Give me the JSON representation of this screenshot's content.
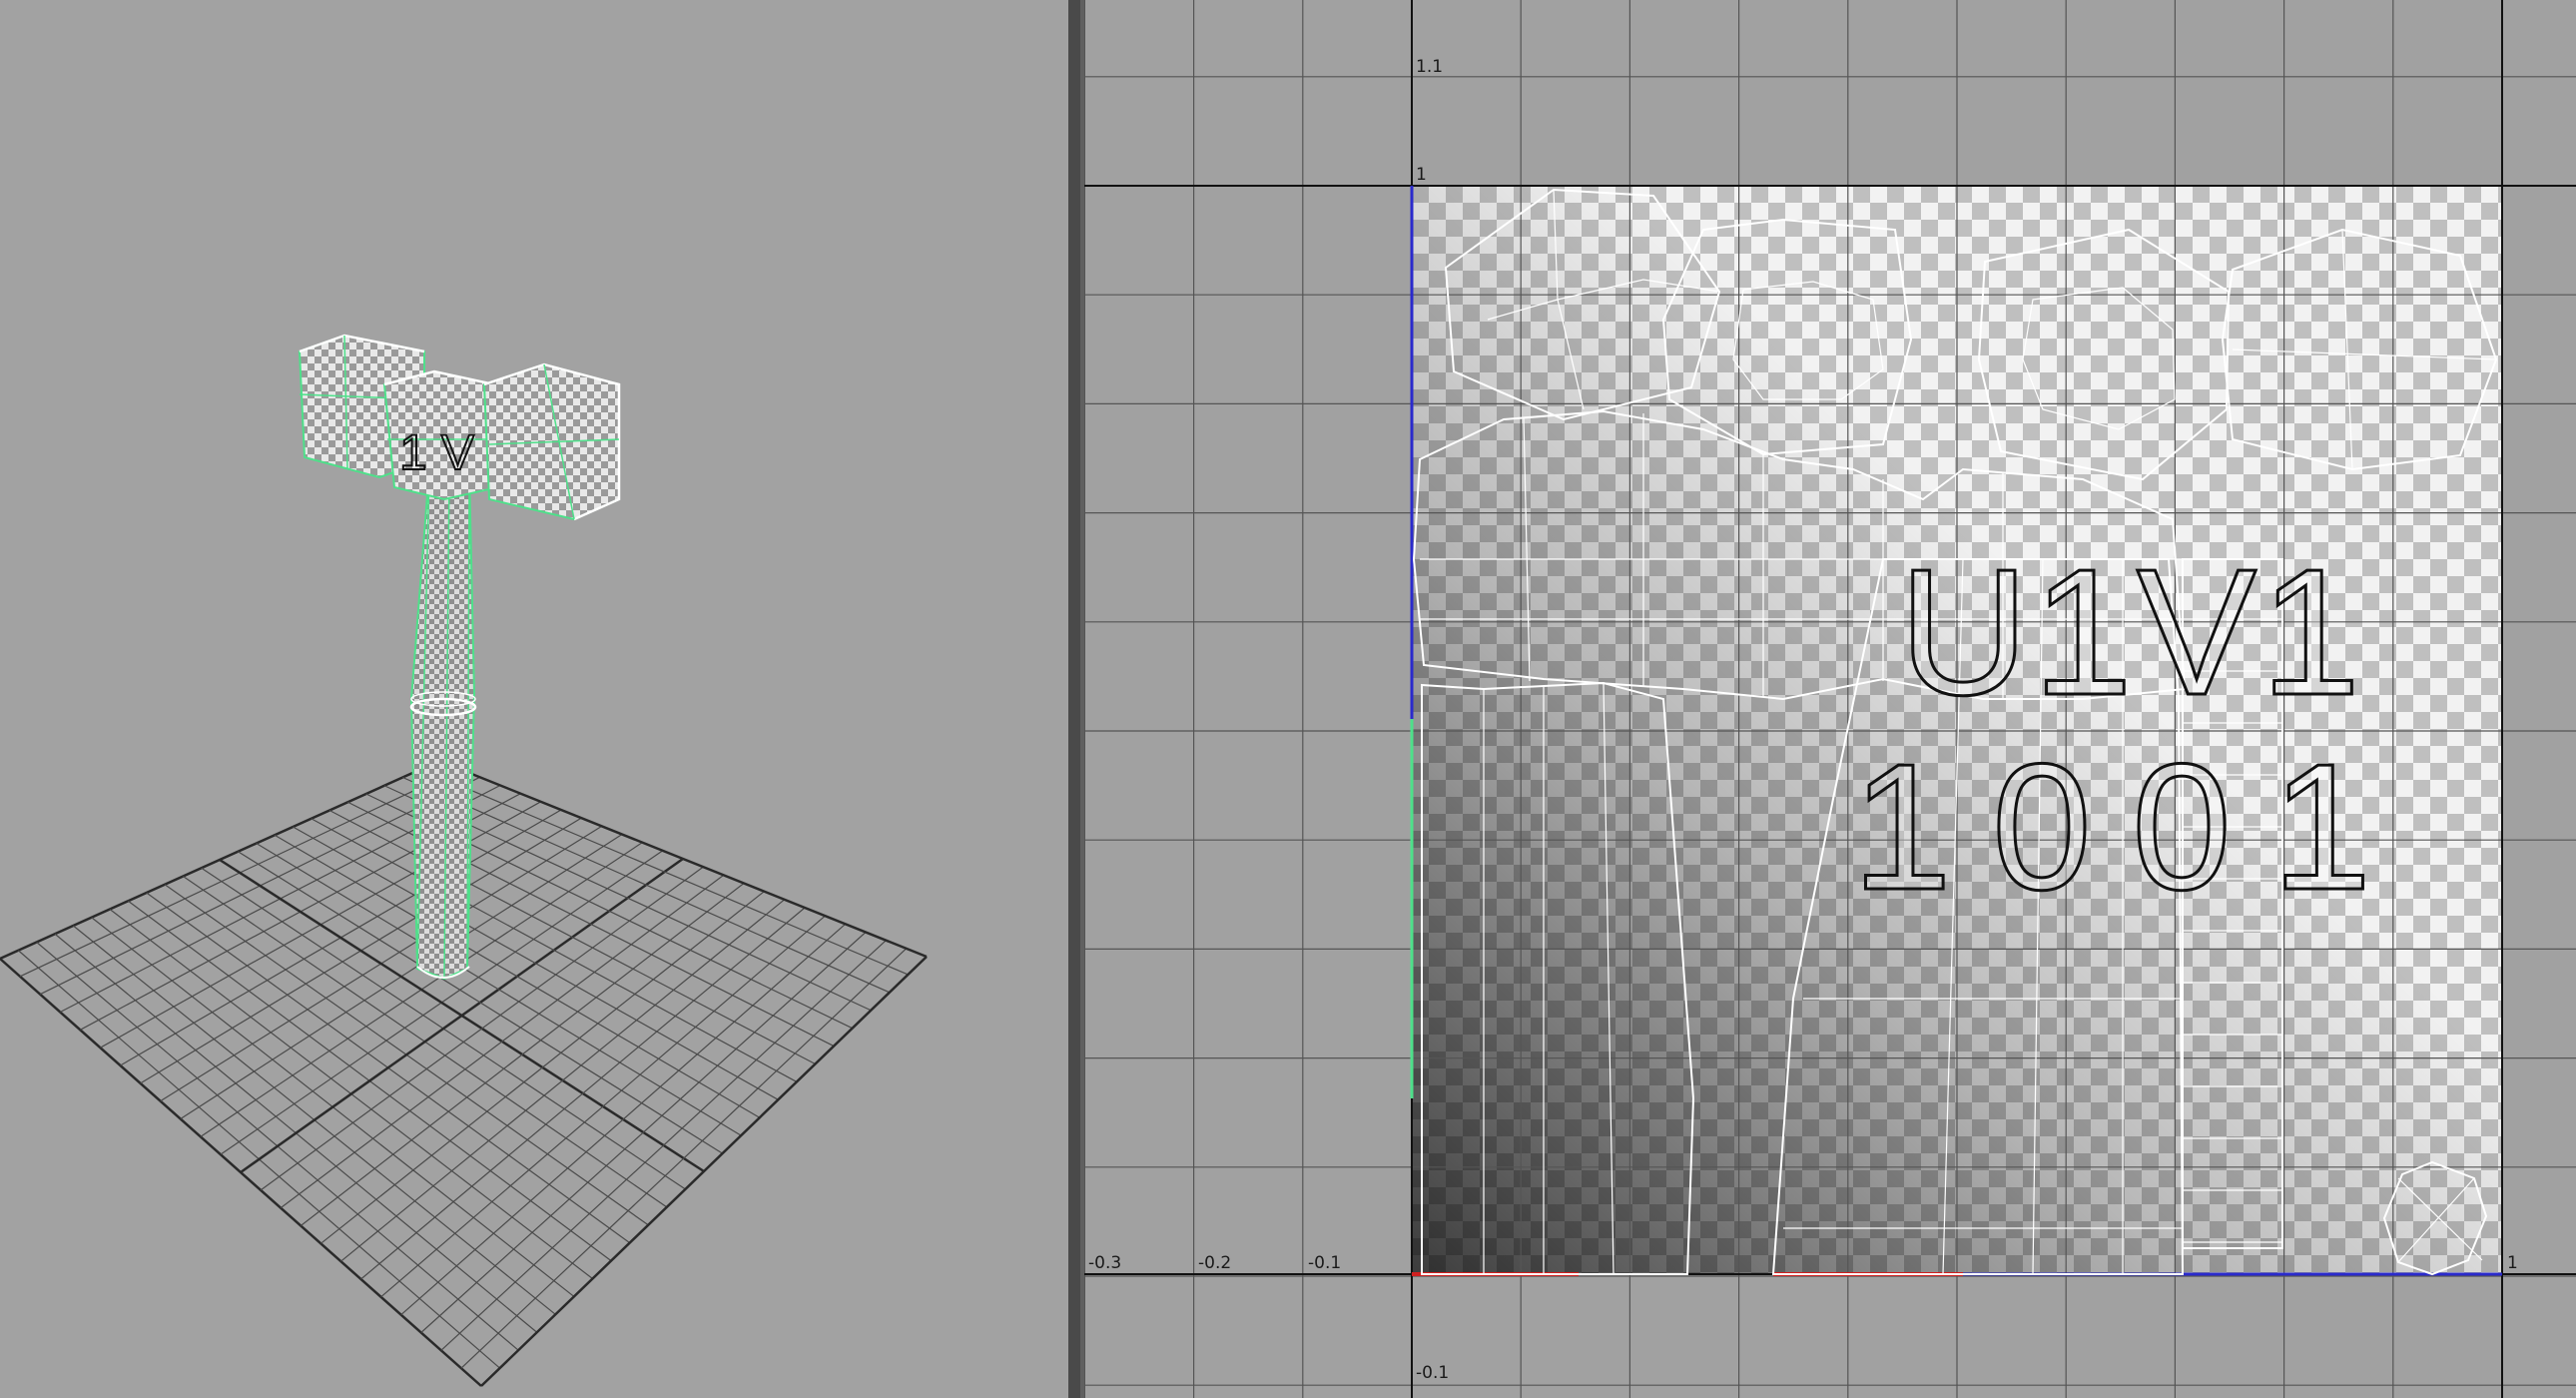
{
  "uv_editor": {
    "tile_label_line1": "U1V1",
    "tile_label_line2": "1001",
    "tick_labels": {
      "u_neg_03": "-0.3",
      "u_neg_02": "-0.2",
      "u_neg_01": "-0.1",
      "u_1": "1",
      "v_1": "1",
      "v_11": "1.1",
      "v_neg_01": "-0.1"
    },
    "colors": {
      "grid_line": "#555555",
      "major_axis": "#111111",
      "uv_shell_edge": "#ffffff",
      "u_axis": "#d02020",
      "v_axis": "#2a2acc",
      "selection_green": "#4ee08a"
    }
  },
  "viewport_3d": {
    "object_name_icon": "hammer-mesh",
    "label_fragment": "1 V"
  }
}
